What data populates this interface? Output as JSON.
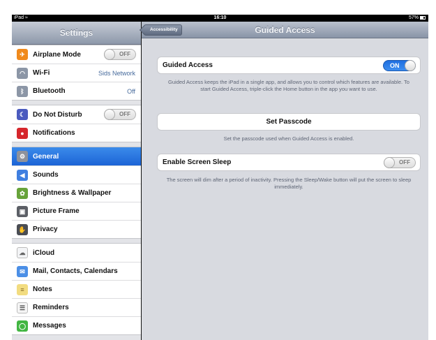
{
  "status_bar": {
    "device": "iPad",
    "time": "16:10",
    "battery": "57%"
  },
  "master": {
    "title": "Settings",
    "groups": [
      {
        "rows": [
          {
            "label": "Airplane Mode",
            "icon": "airplane-icon",
            "icon_color": "#f08a1c",
            "switch": "OFF"
          },
          {
            "label": "Wi-Fi",
            "icon": "wifi-icon",
            "icon_color": "#8c96a6",
            "value": "Sids Network"
          },
          {
            "label": "Bluetooth",
            "icon": "bluetooth-icon",
            "icon_color": "#8c96a6",
            "value": "Off"
          }
        ]
      },
      {
        "rows": [
          {
            "label": "Do Not Disturb",
            "icon": "moon-icon",
            "icon_color": "#4b5bbf",
            "switch": "OFF"
          },
          {
            "label": "Notifications",
            "icon": "notifications-icon",
            "icon_color": "#d6262c"
          }
        ]
      },
      {
        "rows": [
          {
            "label": "General",
            "icon": "gear-icon",
            "icon_color": "#8e929b",
            "selected": true
          },
          {
            "label": "Sounds",
            "icon": "speaker-icon",
            "icon_color": "#3f7fe0"
          },
          {
            "label": "Brightness & Wallpaper",
            "icon": "flower-icon",
            "icon_color": "#67a33a"
          },
          {
            "label": "Picture Frame",
            "icon": "picture-frame-icon",
            "icon_color": "#5c5f66"
          },
          {
            "label": "Privacy",
            "icon": "hand-icon",
            "icon_color": "#4a4d54"
          }
        ]
      },
      {
        "rows": [
          {
            "label": "iCloud",
            "icon": "cloud-icon",
            "icon_color": "#f3f4f6"
          },
          {
            "label": "Mail, Contacts, Calendars",
            "icon": "mail-icon",
            "icon_color": "#4b8fe6"
          },
          {
            "label": "Notes",
            "icon": "notes-icon",
            "icon_color": "#f2dc80"
          },
          {
            "label": "Reminders",
            "icon": "reminders-icon",
            "icon_color": "#f5f5f5"
          },
          {
            "label": "Messages",
            "icon": "messages-icon",
            "icon_color": "#42b642"
          }
        ]
      }
    ]
  },
  "detail": {
    "back_label": "Accessibility",
    "title": "Guided Access",
    "guided_access_label": "Guided Access",
    "guided_access_switch": "ON",
    "guided_access_footer": "Guided Access keeps the iPad in a single app, and allows you to control which features are available. To start Guided Access, triple-click the Home button in the app you want to use.",
    "set_passcode_label": "Set Passcode",
    "set_passcode_footer": "Set the passcode used when Guided Access is enabled.",
    "screen_sleep_label": "Enable Screen Sleep",
    "screen_sleep_switch": "OFF",
    "screen_sleep_footer": "The screen will dim after a period of inactivity. Pressing the Sleep/Wake button will put the screen to sleep immediately."
  }
}
